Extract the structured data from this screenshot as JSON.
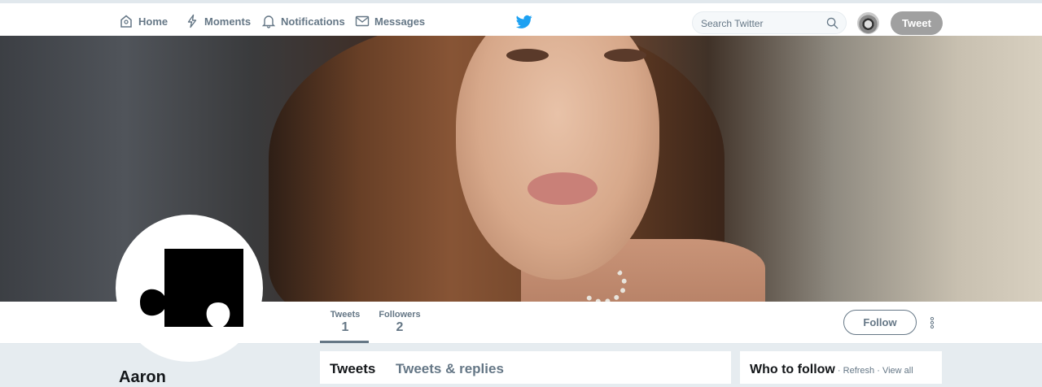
{
  "nav": {
    "home": "Home",
    "moments": "Moments",
    "notifications": "Notifications",
    "messages": "Messages"
  },
  "search": {
    "placeholder": "Search Twitter"
  },
  "tweet_button": "Tweet",
  "profile": {
    "name": "Aaron",
    "stats": {
      "tweets_label": "Tweets",
      "tweets_value": "1",
      "followers_label": "Followers",
      "followers_value": "2"
    },
    "follow_button": "Follow"
  },
  "timeline_tabs": {
    "tweets": "Tweets",
    "replies": "Tweets & replies"
  },
  "who_to_follow": {
    "title": "Who to follow",
    "separator": " · ",
    "refresh": "Refresh",
    "view_all": "View all"
  },
  "colors": {
    "brand": "#1da1f2",
    "text_muted": "#657786",
    "background": "#e6ecf0"
  },
  "icons": [
    "home-icon",
    "moments-icon",
    "notifications-icon",
    "messages-icon",
    "twitter-logo-icon",
    "search-icon",
    "more-options-icon"
  ]
}
